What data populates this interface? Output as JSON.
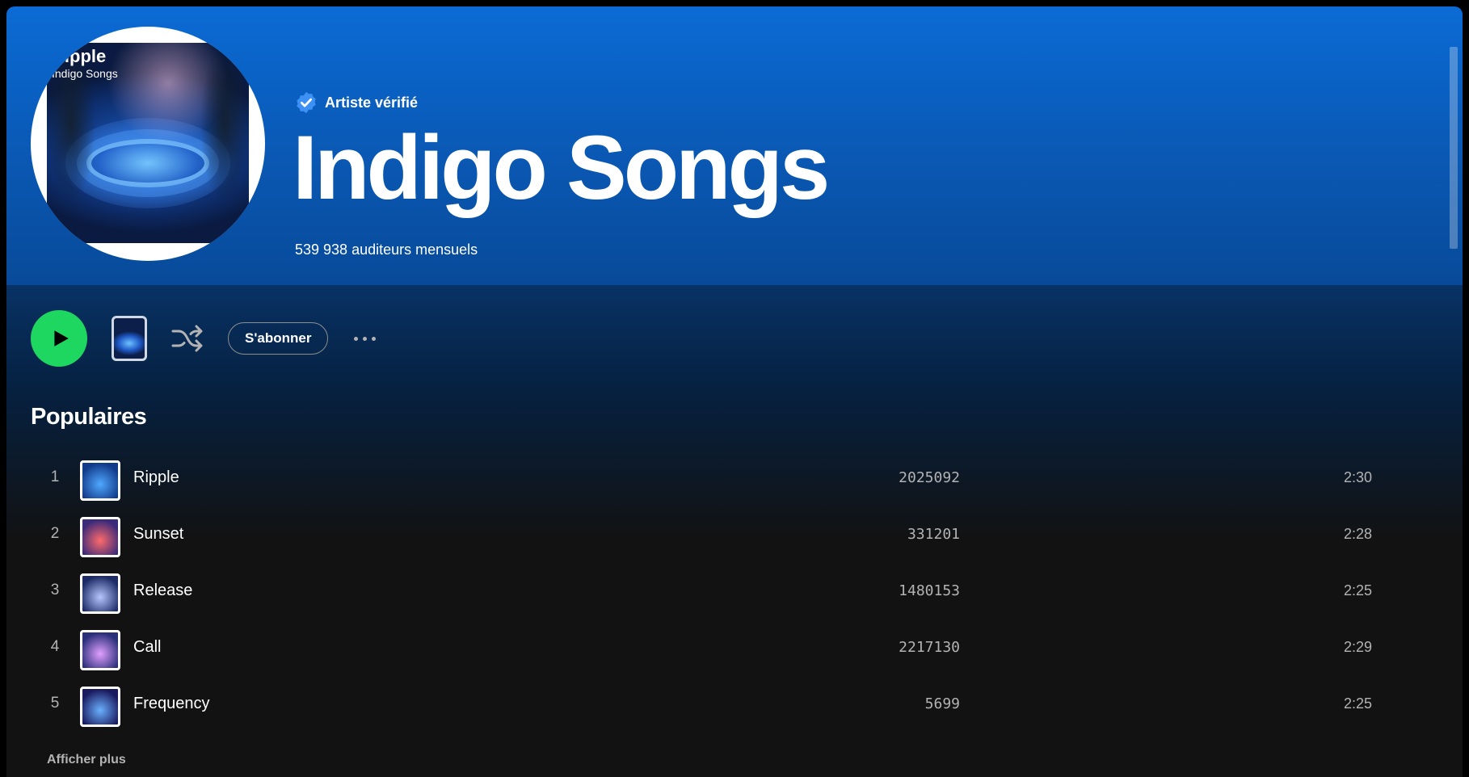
{
  "artist": {
    "verified_label": "Artiste vérifié",
    "name": "Indigo Songs",
    "monthly_listeners": "539 938 auditeurs mensuels",
    "cover": {
      "title": "Ripple",
      "subtitle": "Indigo Songs"
    }
  },
  "controls": {
    "play_icon": "play-icon",
    "shuffle_icon": "shuffle-icon",
    "follow_label": "S'abonner",
    "more_icon": "more-options-icon"
  },
  "popular": {
    "title": "Populaires",
    "tracks": [
      {
        "rank": "1",
        "title": "Ripple",
        "plays": "2025092",
        "duration": "2:30",
        "thumb_colors": [
          "#4fa8ff",
          "#123a8a"
        ]
      },
      {
        "rank": "2",
        "title": "Sunset",
        "plays": "331201",
        "duration": "2:28",
        "thumb_colors": [
          "#ff6a6a",
          "#3a2a7a"
        ]
      },
      {
        "rank": "3",
        "title": "Release",
        "plays": "1480153",
        "duration": "2:25",
        "thumb_colors": [
          "#b7c6ff",
          "#1d2c66"
        ]
      },
      {
        "rank": "4",
        "title": "Call",
        "plays": "2217130",
        "duration": "2:29",
        "thumb_colors": [
          "#e0a0ff",
          "#2a2f7a"
        ]
      },
      {
        "rank": "5",
        "title": "Frequency",
        "plays": "5699",
        "duration": "2:25",
        "thumb_colors": [
          "#6ab0ff",
          "#1a1a5e"
        ]
      }
    ],
    "show_more_label": "Afficher plus"
  },
  "colors": {
    "accent_green": "#1ed760",
    "hero_blue": "#0b6bd5",
    "verified_blue": "#3d91f4"
  }
}
